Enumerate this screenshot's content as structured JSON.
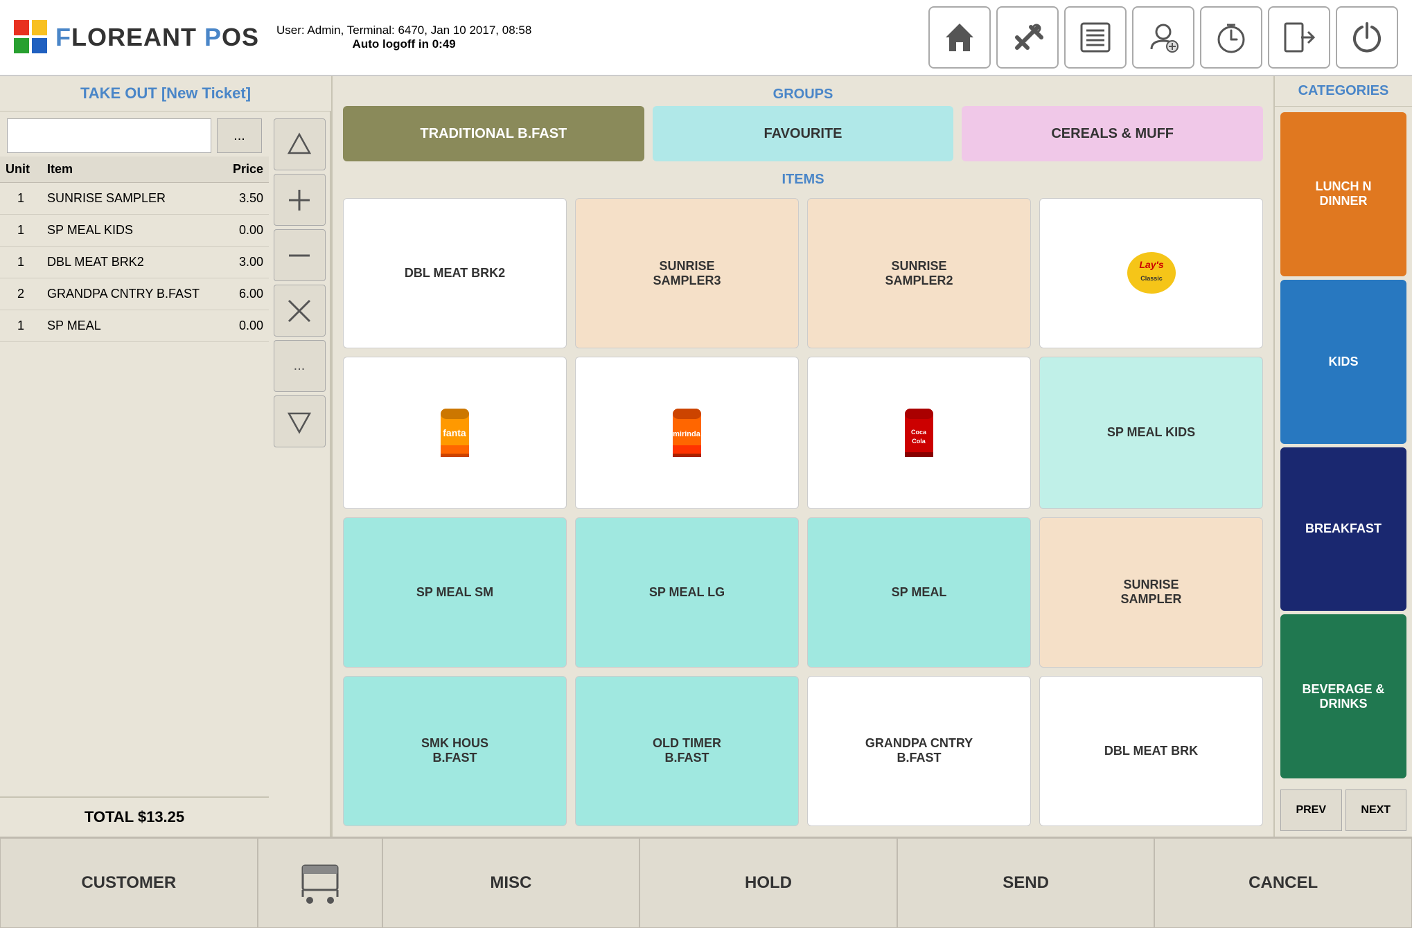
{
  "header": {
    "logo_text": "FLOREANT POS",
    "user_info": "User: Admin, Terminal: 6470, Jan 10 2017, 08:58",
    "auto_logoff": "Auto logoff in 0:49",
    "buttons": [
      {
        "name": "home-icon",
        "symbol": "🏠"
      },
      {
        "name": "tools-icon",
        "symbol": "🔧"
      },
      {
        "name": "list-icon",
        "symbol": "📋"
      },
      {
        "name": "user-settings-icon",
        "symbol": "👤"
      },
      {
        "name": "timer-icon",
        "symbol": "⏱"
      },
      {
        "name": "exit-icon",
        "symbol": "➡"
      },
      {
        "name": "power-icon",
        "symbol": "⏻"
      }
    ]
  },
  "ticket": {
    "title": "TAKE OUT [New Ticket]",
    "input_placeholder": "",
    "ellipsis": "...",
    "columns": [
      "Unit",
      "Item",
      "Price"
    ],
    "items": [
      {
        "unit": 1,
        "name": "SUNRISE SAMPLER",
        "price": "3.50"
      },
      {
        "unit": 1,
        "name": "SP MEAL KIDS",
        "price": "0.00"
      },
      {
        "unit": 1,
        "name": "DBL MEAT BRK2",
        "price": "3.00"
      },
      {
        "unit": 2,
        "name": "GRANDPA CNTRY B.FAST",
        "price": "6.00"
      },
      {
        "unit": 1,
        "name": "SP MEAL",
        "price": "0.00"
      }
    ],
    "total_label": "TOTAL $13.25"
  },
  "controls": {
    "up": "△",
    "plus": "+",
    "minus": "−",
    "cancel": "×",
    "more": "...",
    "down": "▽"
  },
  "groups": {
    "label": "GROUPS",
    "buttons": [
      {
        "label": "TRADITIONAL B.FAST",
        "style": "active"
      },
      {
        "label": "FAVOURITE",
        "style": "light-blue"
      },
      {
        "label": "CEREALS & MUFF",
        "style": "light-pink"
      }
    ]
  },
  "items": {
    "label": "ITEMS",
    "grid": [
      {
        "label": "DBL MEAT BRK2",
        "style": "plain",
        "has_image": false
      },
      {
        "label": "SUNRISE\nSAMPLER3",
        "style": "peach",
        "has_image": false
      },
      {
        "label": "SUNRISE\nSAMPLER2",
        "style": "peach",
        "has_image": false
      },
      {
        "label": "LAYS",
        "style": "plain",
        "has_image": true,
        "image_type": "lays"
      },
      {
        "label": "FANTA",
        "style": "plain",
        "has_image": true,
        "image_type": "fanta"
      },
      {
        "label": "MIRINDA",
        "style": "plain",
        "has_image": true,
        "image_type": "mirinda"
      },
      {
        "label": "COCA-COLA",
        "style": "plain",
        "has_image": true,
        "image_type": "cocacola"
      },
      {
        "label": "SP MEAL KIDS",
        "style": "light-teal",
        "has_image": false
      },
      {
        "label": "SP MEAL SM",
        "style": "teal",
        "has_image": false
      },
      {
        "label": "SP MEAL LG",
        "style": "teal",
        "has_image": false
      },
      {
        "label": "SP MEAL",
        "style": "teal",
        "has_image": false
      },
      {
        "label": "SUNRISE\nSAMPLER",
        "style": "peach",
        "has_image": false
      },
      {
        "label": "SMK HOUS\nB.FAST",
        "style": "teal",
        "has_image": false
      },
      {
        "label": "OLD TIMER\nB.FAST",
        "style": "teal",
        "has_image": false
      },
      {
        "label": "GRANDPA CNTRY\nB.FAST",
        "style": "plain",
        "has_image": false
      },
      {
        "label": "DBL MEAT BRK",
        "style": "plain",
        "has_image": false
      }
    ]
  },
  "categories": {
    "label": "CATEGORIES",
    "buttons": [
      {
        "label": "LUNCH N\nDINNER",
        "style": "orange"
      },
      {
        "label": "KIDS",
        "style": "blue"
      },
      {
        "label": "BREAKFAST",
        "style": "dark-blue"
      },
      {
        "label": "BEVERAGE &\nDRINKS",
        "style": "green"
      }
    ],
    "prev": "PREV",
    "next": "NEXT"
  },
  "footer": {
    "customer": "CUSTOMER",
    "cart_icon": "🛒",
    "misc": "MISC",
    "hold": "HOLD",
    "send": "SEND",
    "cancel": "CANCEL"
  }
}
